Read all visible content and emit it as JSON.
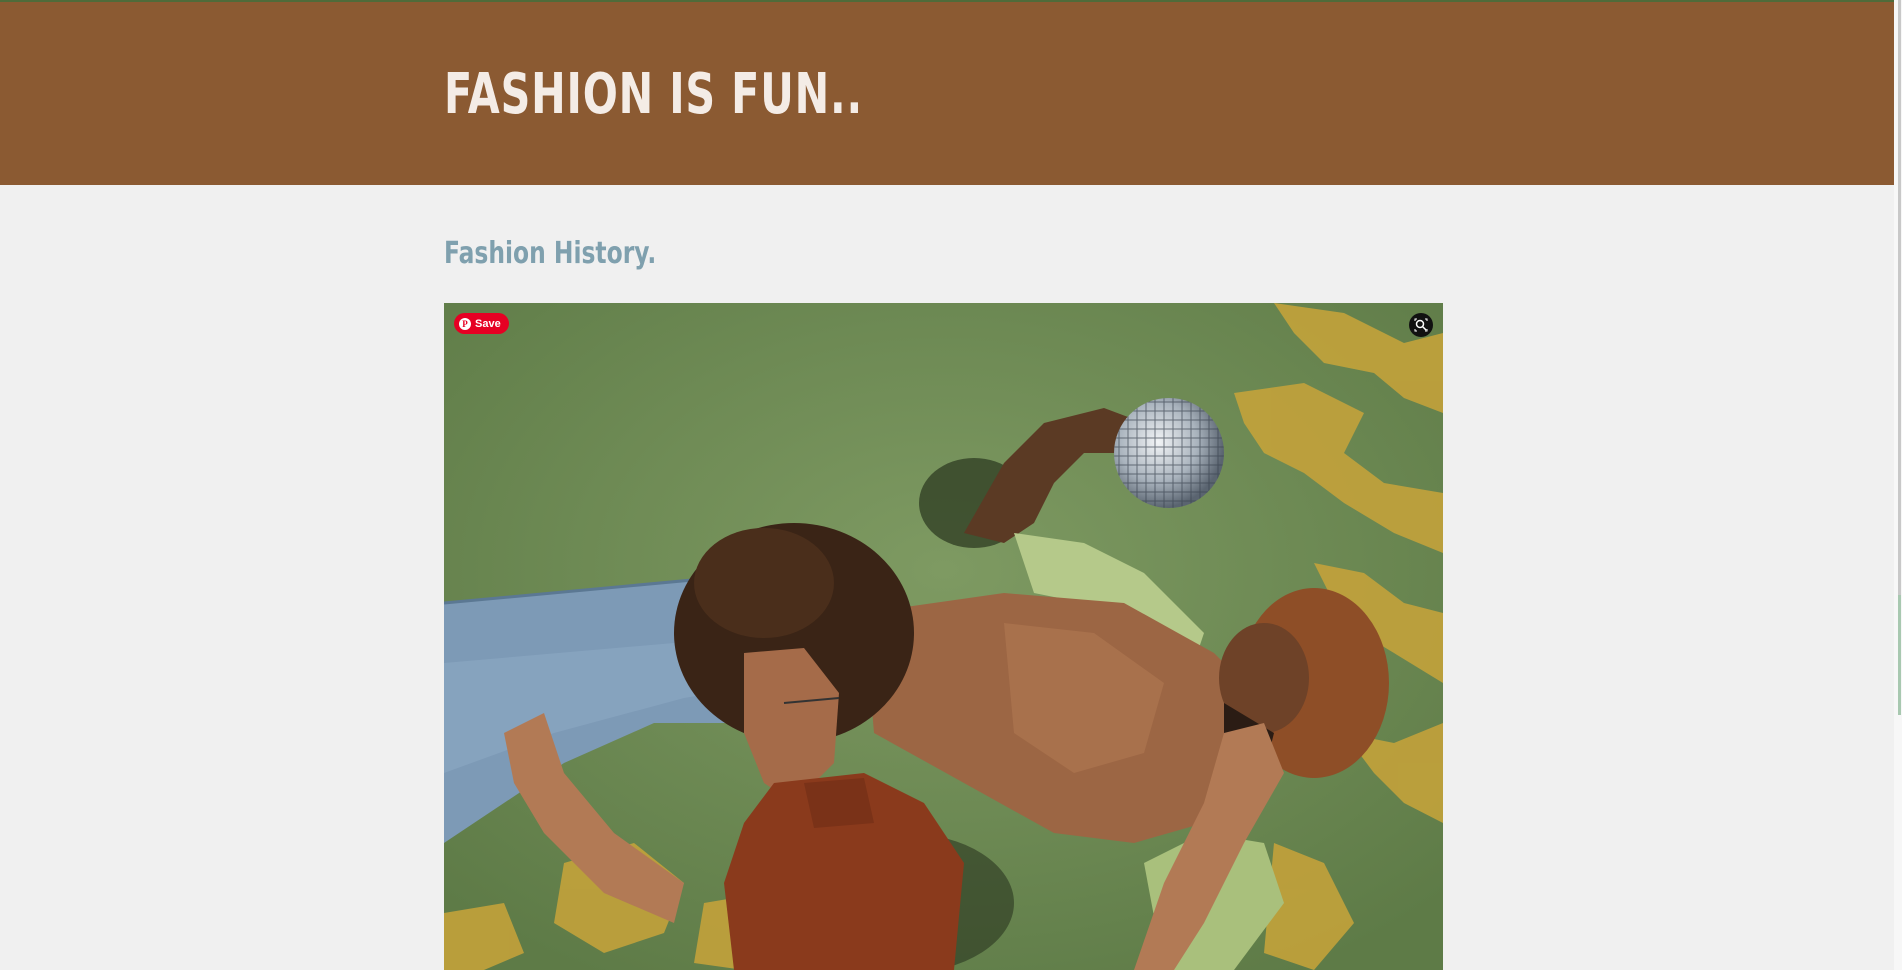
{
  "header": {
    "title": "FASHION IS FUN.."
  },
  "main": {
    "section_title": "Fashion History."
  },
  "image": {
    "save_label": "Save",
    "save_icon": "pinterest-icon",
    "lens_icon": "visual-search-icon"
  },
  "colors": {
    "header_bg": "#8b5a32",
    "title_color": "#f4ece6",
    "section_title_color": "#7fa0ae",
    "save_button": "#e60023",
    "page_bg": "#f0f0f0"
  }
}
